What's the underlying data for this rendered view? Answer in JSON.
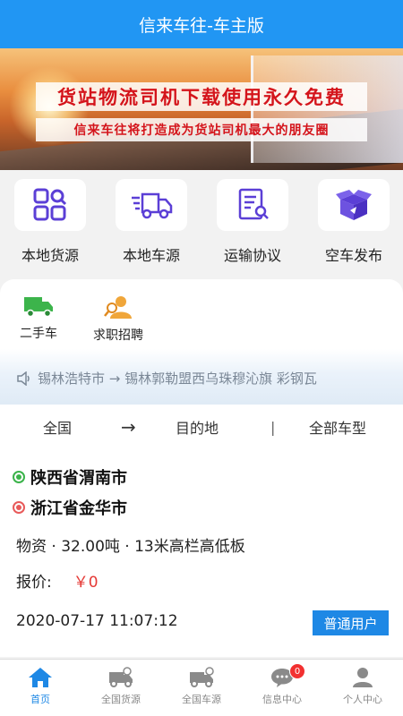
{
  "header": {
    "title": "信来车往-车主版"
  },
  "banner": {
    "headline": "货站物流司机下载使用永久免费",
    "subline": "信来车往将打造成为货站司机最大的朋友圈",
    "slide_count": 7,
    "active_slide": 2
  },
  "quick_menu": [
    {
      "label": "本地货源",
      "icon": "grid-search-icon"
    },
    {
      "label": "本地车源",
      "icon": "truck-icon"
    },
    {
      "label": "运输协议",
      "icon": "document-icon"
    },
    {
      "label": "空车发布",
      "icon": "box-icon"
    }
  ],
  "secondary_menu": [
    {
      "label": "二手车",
      "icon": "green-truck-icon"
    },
    {
      "label": "求职招聘",
      "icon": "worker-icon"
    }
  ],
  "ticker": {
    "icon": "speaker-icon",
    "text": "锡林浩特市 → 锡林郭勒盟西乌珠穆沁旗 彩钢瓦"
  },
  "filter": {
    "from": "全国",
    "arrow": "→",
    "to": "目的地",
    "separator": "|",
    "vehicle_type": "全部车型"
  },
  "order": {
    "origin": "陕西省渭南市",
    "destination": "浙江省金华市",
    "cargo": "物资 · 32.00吨 · 13米高栏高低板",
    "price_label": "报价:",
    "price_value": "￥0",
    "time": "2020-07-17 11:07:12",
    "user_badge": "普通用户"
  },
  "tabbar": [
    {
      "label": "首页",
      "icon": "home-icon",
      "active": true
    },
    {
      "label": "全国货源",
      "icon": "truck-cargo-icon",
      "active": false
    },
    {
      "label": "全国车源",
      "icon": "truck-search-icon",
      "active": false
    },
    {
      "label": "信息中心",
      "icon": "message-icon",
      "active": false,
      "badge": "0"
    },
    {
      "label": "个人中心",
      "icon": "user-icon",
      "active": false
    }
  ],
  "colors": {
    "primary": "#2196f3",
    "accent_purple": "#5b3fd6",
    "price_red": "#e53935"
  }
}
